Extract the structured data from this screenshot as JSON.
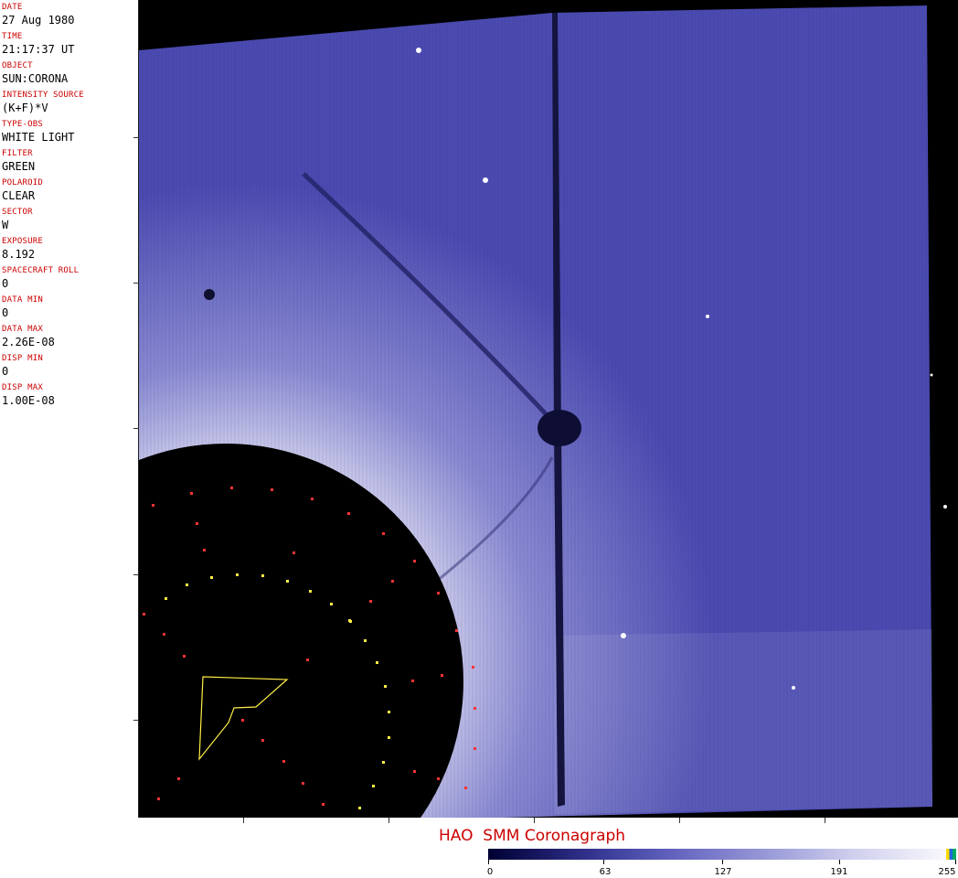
{
  "metadata": [
    {
      "label": "DATE",
      "value": "27 Aug 1980"
    },
    {
      "label": "TIME",
      "value": "21:17:37 UT"
    },
    {
      "label": "OBJECT",
      "value": "SUN:CORONA"
    },
    {
      "label": "INTENSITY SOURCE",
      "value": "(K+F)*V"
    },
    {
      "label": "TYPE-OBS",
      "value": "WHITE LIGHT"
    },
    {
      "label": "FILTER",
      "value": "GREEN"
    },
    {
      "label": "POLAROID",
      "value": "CLEAR"
    },
    {
      "label": "SECTOR",
      "value": "W"
    },
    {
      "label": "EXPOSURE",
      "value": "8.192"
    },
    {
      "label": "SPACECRAFT ROLL",
      "value": "0"
    },
    {
      "label": "DATA MIN",
      "value": "0"
    },
    {
      "label": "DATA MAX",
      "value": "2.26E-08"
    },
    {
      "label": "DISP MIN",
      "value": "0"
    },
    {
      "label": "DISP MAX",
      "value": "1.00E-08"
    }
  ],
  "title": "HAO  SMM Coronagraph",
  "colorbar": {
    "labels": [
      "0",
      "63",
      "127",
      "191",
      "255"
    ],
    "colors": {
      "low": "#000033",
      "mid": "#6464c0",
      "high": "#ffffff"
    }
  }
}
